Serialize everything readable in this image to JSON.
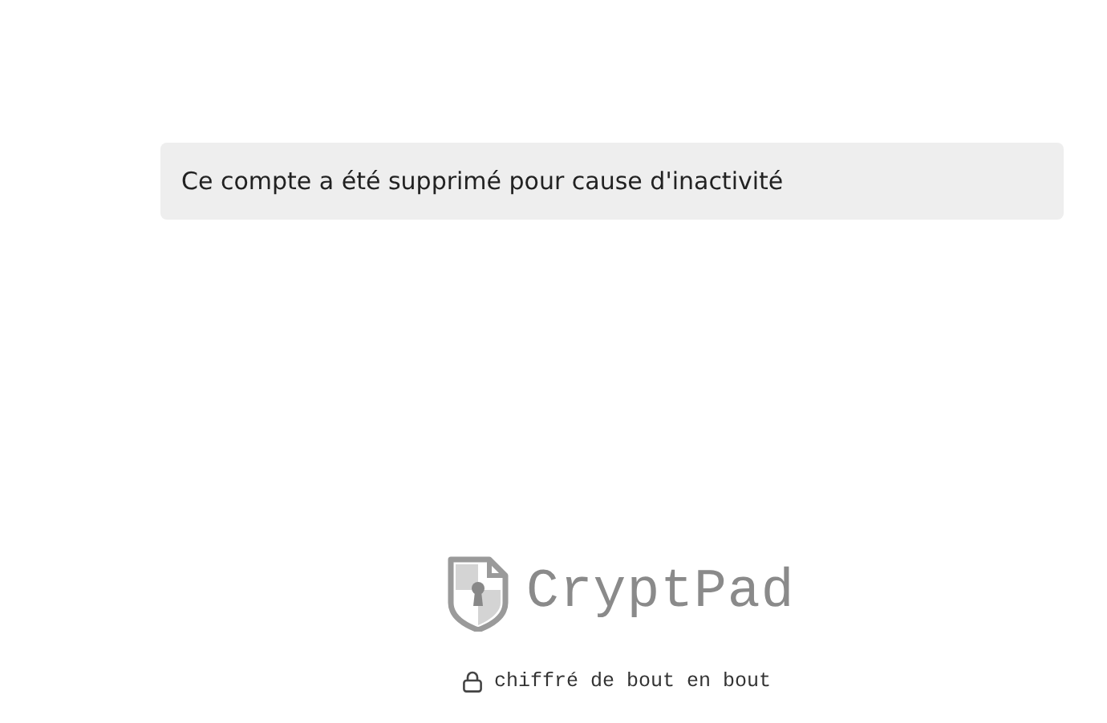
{
  "message": "Ce compte a été supprimé pour cause d'inactivité",
  "logo": {
    "name": "CryptPad"
  },
  "footer": {
    "text": "chiffré de bout en bout"
  }
}
